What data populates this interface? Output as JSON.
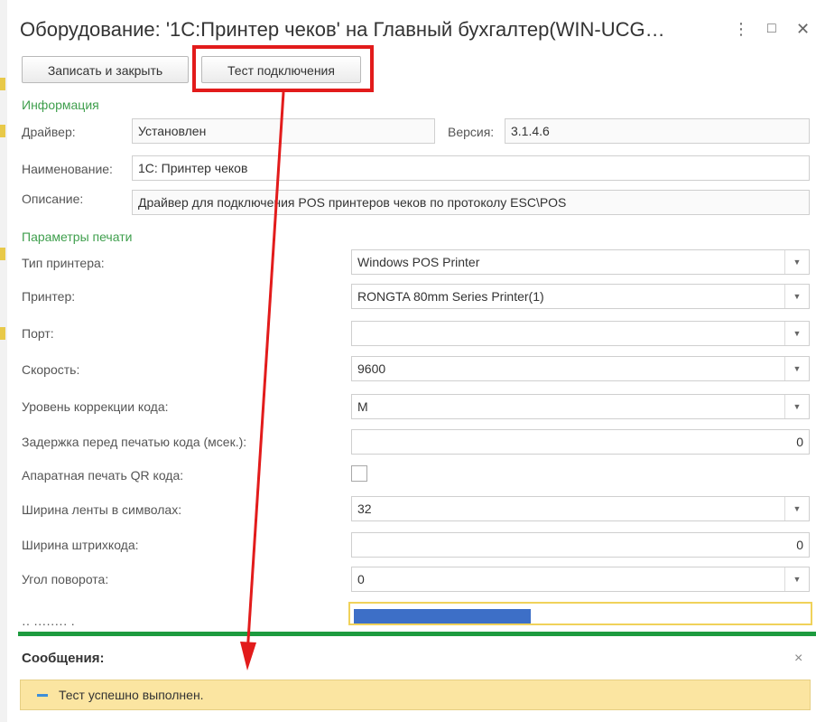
{
  "window": {
    "title": "Оборудование: '1С:Принтер чеков' на Главный бухгалтер(WIN-UCG…",
    "more_icon": "⋮",
    "maximize_icon": "□",
    "close_icon": "✕"
  },
  "toolbar": {
    "save_close_label": "Записать и закрыть",
    "test_connection_label": "Тест подключения"
  },
  "info": {
    "group_label": "Информация",
    "driver_label": "Драйвер:",
    "driver_value": "Установлен",
    "version_label": "Версия:",
    "version_value": "3.1.4.6",
    "name_label": "Наименование:",
    "name_value": "1С: Принтер чеков",
    "desc_label": "Описание:",
    "desc_value": "Драйвер для подключения POS принтеров чеков по протоколу ESC\\POS"
  },
  "print": {
    "group_label": "Параметры печати",
    "printer_type_label": "Тип принтера:",
    "printer_type_value": "Windows POS Printer",
    "printer_label": "Принтер:",
    "printer_value": "RONGTA 80mm Series Printer(1)",
    "port_label": "Порт:",
    "port_value": "",
    "speed_label": "Скорость:",
    "speed_value": "9600",
    "correction_label": "Уровень коррекции кода:",
    "correction_value": "M",
    "delay_label": "Задержка перед печатью кода (мсек.):",
    "delay_value": "0",
    "qr_label": "Апаратная печать QR кода:",
    "tape_width_label": "Ширина ленты в символах:",
    "tape_width_value": "32",
    "barcode_width_label": "Ширина штрихкода:",
    "barcode_width_value": "0",
    "rotation_label": "Угол поворота:",
    "rotation_value": "0"
  },
  "messages": {
    "title": "Сообщения:",
    "close_icon": "×",
    "text": "Тест успешно выполнен."
  },
  "colors": {
    "annotation_red": "#e21b1b",
    "group_green": "#3f9f4d",
    "message_yellow": "#fbe5a1"
  }
}
